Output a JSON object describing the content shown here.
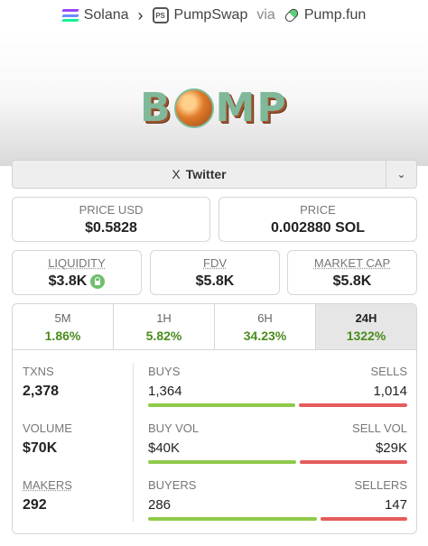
{
  "breadcrumb": {
    "chain": "Solana",
    "dex": "PumpSwap",
    "via": "via",
    "launchpad": "Pump.fun"
  },
  "banner": {
    "logo_text_left": "B",
    "logo_text_right": "MP"
  },
  "social": {
    "twitter_label": "Twitter",
    "twitter_glyph": "X",
    "dropdown_glyph": "⌄"
  },
  "price": {
    "usd_label": "PRICE USD",
    "usd_value": "$0.5828",
    "native_label": "PRICE",
    "native_value": "0.002880 SOL"
  },
  "metrics": {
    "liquidity_label": "LIQUIDITY",
    "liquidity_value": "$3.8K",
    "fdv_label": "FDV",
    "fdv_value": "$5.8K",
    "mcap_label": "MARKET CAP",
    "mcap_value": "$5.8K"
  },
  "timeframes": [
    {
      "label": "5M",
      "change": "1.86%"
    },
    {
      "label": "1H",
      "change": "5.82%"
    },
    {
      "label": "6H",
      "change": "34.23%"
    },
    {
      "label": "24H",
      "change": "1322%"
    }
  ],
  "stats": {
    "txns_label": "TXNS",
    "txns_value": "2,378",
    "volume_label": "VOLUME",
    "volume_value": "$70K",
    "makers_label": "MAKERS",
    "makers_value": "292",
    "buys_label": "BUYS",
    "buys_value": "1,364",
    "sells_label": "SELLS",
    "sells_value": "1,014",
    "buys_fraction": 0.574,
    "buyvol_label": "BUY VOL",
    "buyvol_value": "$40K",
    "sellvol_label": "SELL VOL",
    "sellvol_value": "$29K",
    "buyvol_fraction": 0.58,
    "buyers_label": "BUYERS",
    "buyers_value": "286",
    "sellers_label": "SELLERS",
    "sellers_value": "147",
    "buyers_fraction": 0.66
  },
  "colors": {
    "positive": "#4a8c1c",
    "buy_bar": "#8fca4a",
    "sell_bar": "#e55c5c",
    "logo_green": "#7fb99a",
    "logo_brown": "#a0522d"
  }
}
